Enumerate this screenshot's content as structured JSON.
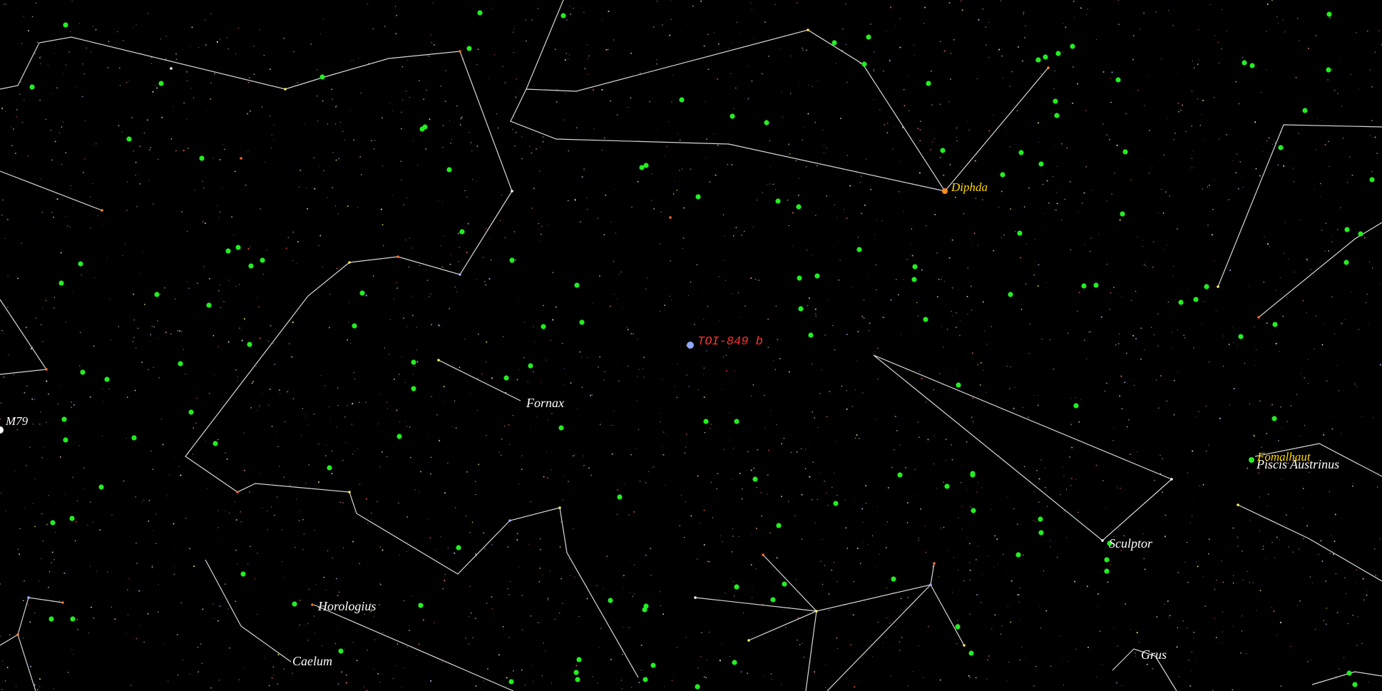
{
  "sky_map": {
    "constellations": [
      {
        "name": "Fornax"
      },
      {
        "name": "Sculptor"
      },
      {
        "name": "Horologius"
      },
      {
        "name": "Caelum"
      },
      {
        "name": "Grus"
      },
      {
        "name": "Piscis Austrinus"
      }
    ],
    "named_stars": [
      {
        "name": "Diphda"
      },
      {
        "name": "Fomalhaut"
      }
    ],
    "target": {
      "name": "TOI-849 b"
    },
    "deep_sky_objects": [
      {
        "name": "M79"
      }
    ],
    "colors": {
      "background": "#000000",
      "constellation_line": "#d8d8d8",
      "constellation_label": "#ffffff",
      "star_label": "#ffd800",
      "target_label": "#ff3030",
      "target_marker": "#8fa8ff",
      "marker": "#22ee22"
    }
  }
}
